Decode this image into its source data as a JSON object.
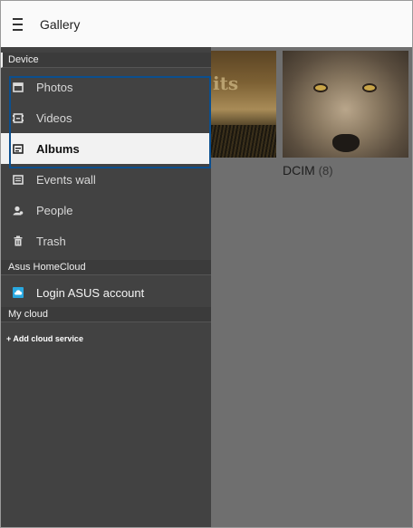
{
  "appbar": {
    "title": "Gallery",
    "menu_icon": "hamburger-menu-icon"
  },
  "drawer": {
    "sections": {
      "device": "Device",
      "homecloud": "Asus HomeCloud",
      "mycloud": "My cloud"
    },
    "items": [
      {
        "label": "Photos",
        "icon": "photos-icon"
      },
      {
        "label": "Videos",
        "icon": "videos-icon"
      },
      {
        "label": "Albums",
        "icon": "albums-icon",
        "selected": true
      },
      {
        "label": "Events wall",
        "icon": "events-wall-icon"
      },
      {
        "label": "People",
        "icon": "people-icon"
      },
      {
        "label": "Trash",
        "icon": "trash-icon"
      }
    ],
    "login": {
      "label": "Login ASUS account",
      "icon": "cloud-icon"
    },
    "add_cloud": {
      "label": "+ Add cloud service"
    }
  },
  "content": {
    "album": {
      "name": "DCIM",
      "count": "(8)"
    },
    "partial_thumb_text": "its"
  },
  "colors": {
    "drawer_bg": "#424242",
    "selected_bg": "#f2f2f2",
    "highlight_border": "#0b4f8f",
    "login_icon": "#29a8e0"
  }
}
